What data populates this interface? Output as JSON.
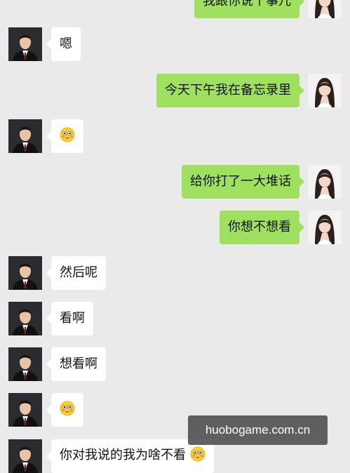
{
  "chat": {
    "messages": [
      {
        "side": "right",
        "text": "我跟你说个事儿",
        "emoji": false
      },
      {
        "side": "left",
        "text": "嗯",
        "emoji": false
      },
      {
        "side": "right",
        "text": "今天下午我在备忘录里",
        "emoji": false
      },
      {
        "side": "left",
        "text": "",
        "emoji": true
      },
      {
        "side": "right",
        "text": "给你打了一大堆话",
        "emoji": false
      },
      {
        "side": "right",
        "text": "你想不想看",
        "emoji": false
      },
      {
        "side": "left",
        "text": "然后呢",
        "emoji": false
      },
      {
        "side": "left",
        "text": "看啊",
        "emoji": false
      },
      {
        "side": "left",
        "text": "想看啊",
        "emoji": false
      },
      {
        "side": "left",
        "text": "",
        "emoji": true
      },
      {
        "side": "left",
        "text": "你对我说的我为啥不看",
        "emoji": true
      }
    ]
  },
  "watermark": "huobogame.com.cn",
  "colors": {
    "background": "#eaeaea",
    "bubble_sent": "#9fe15f",
    "bubble_received": "#ffffff"
  }
}
